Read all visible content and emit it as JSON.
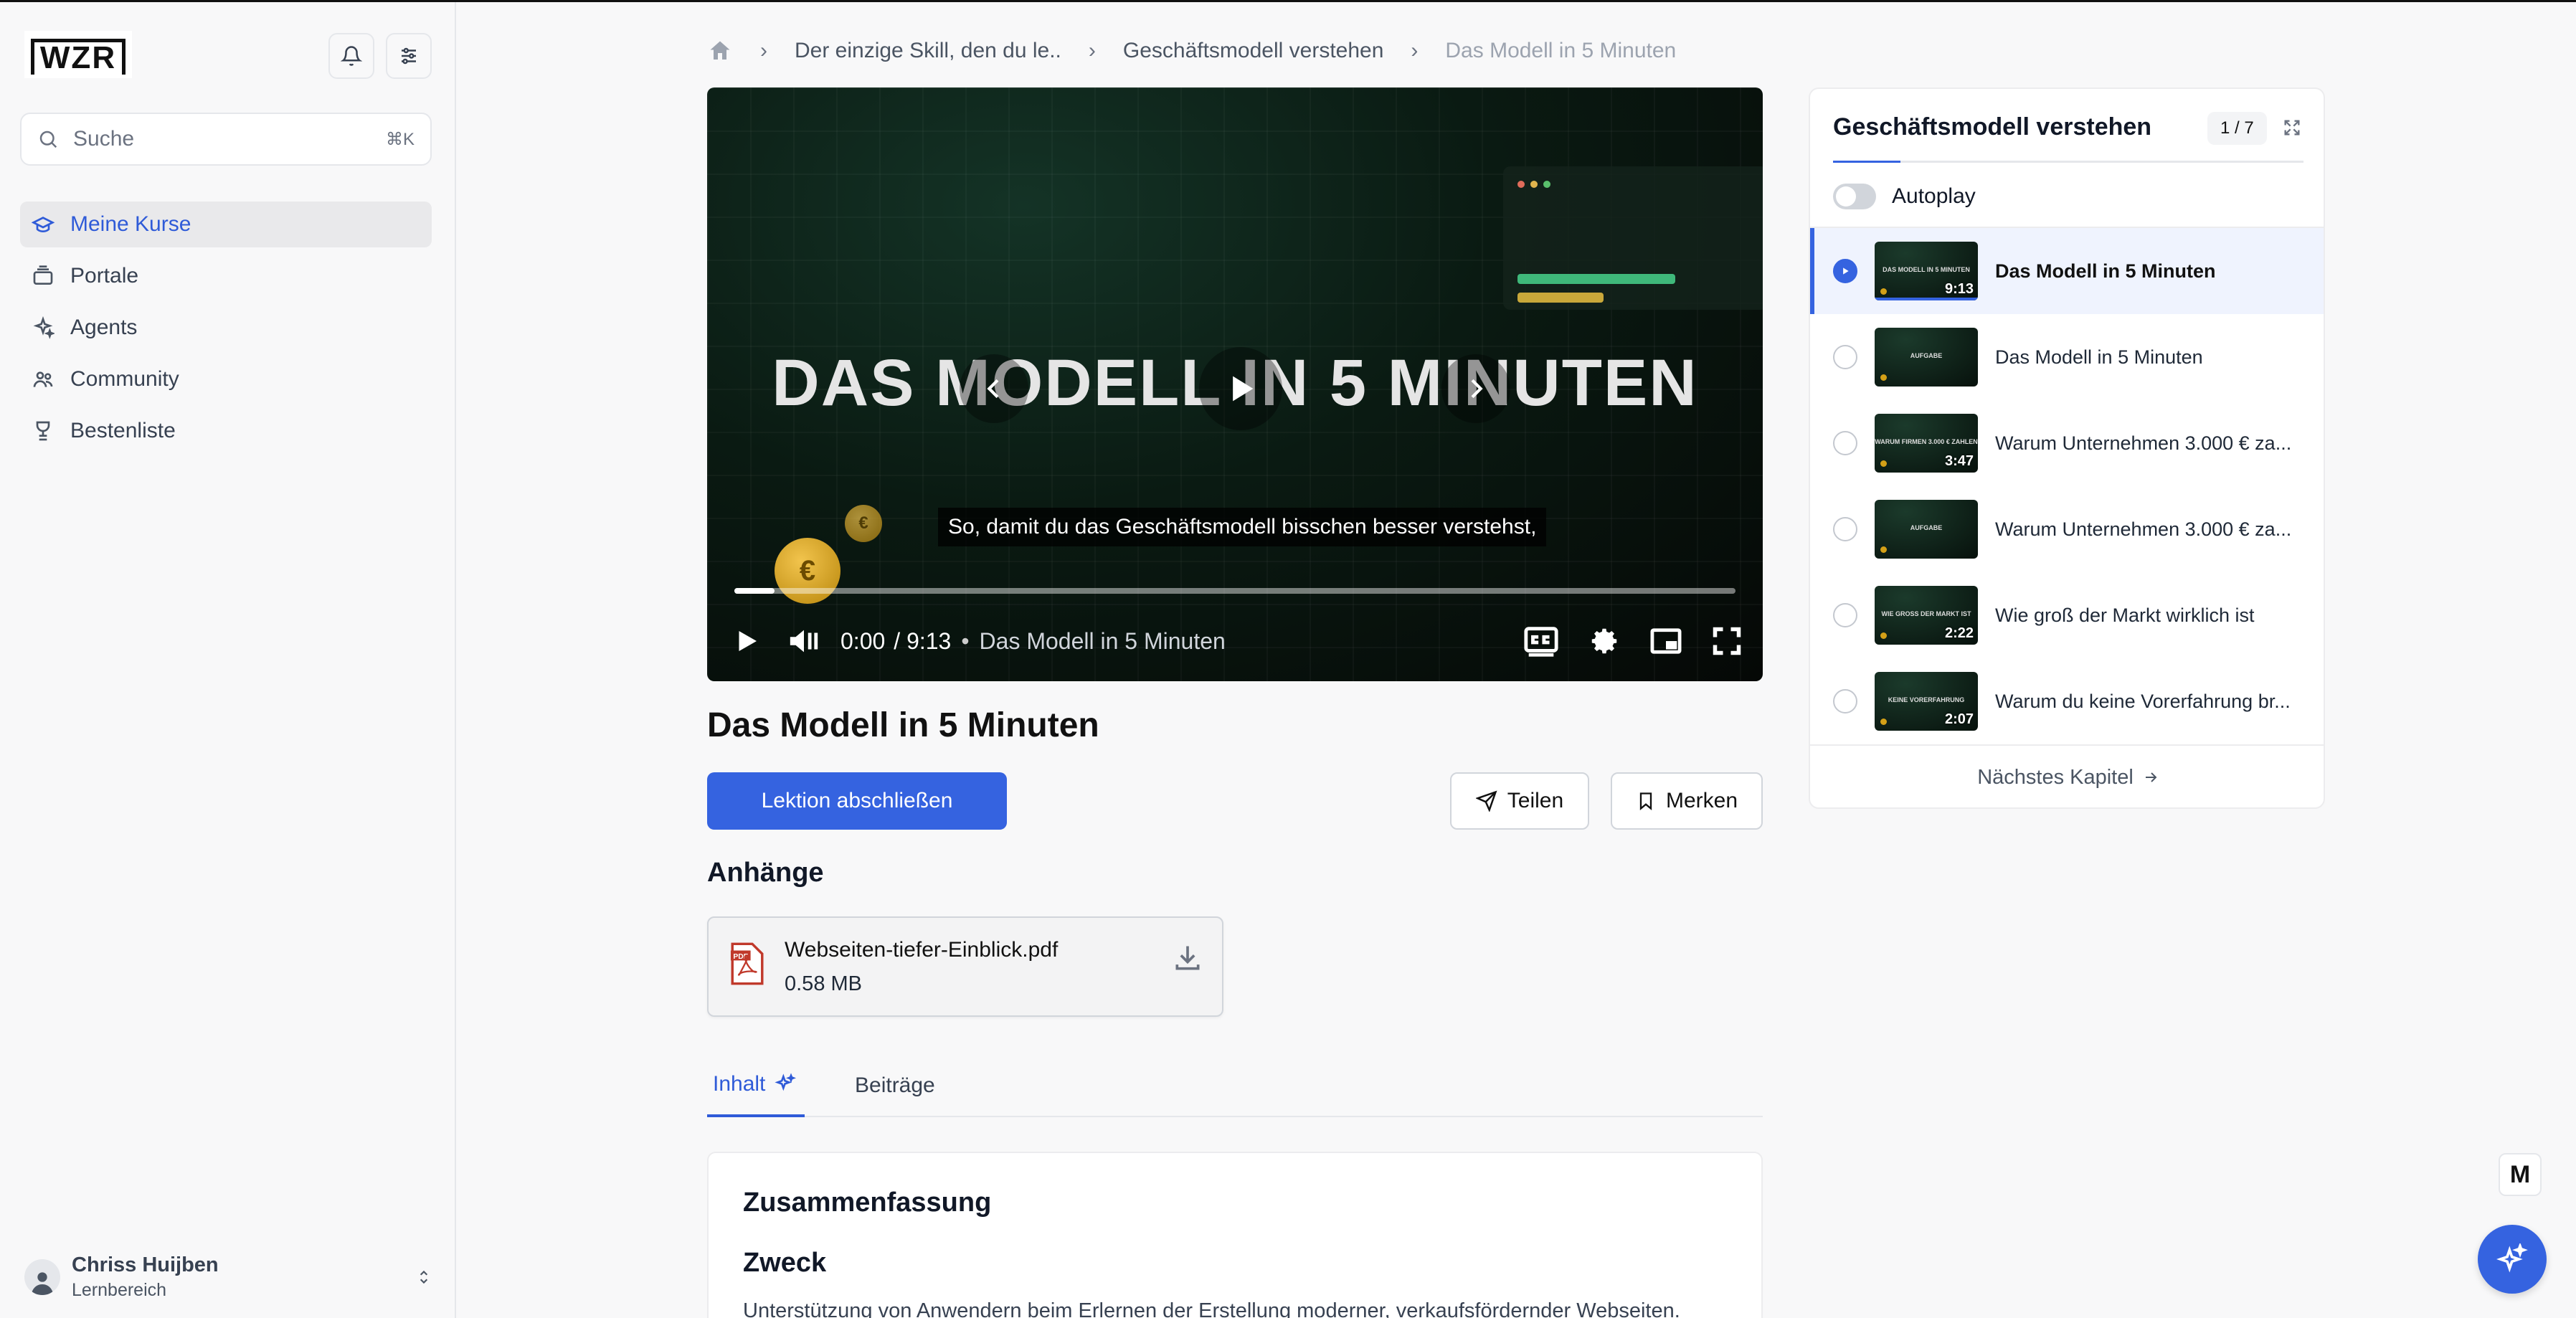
{
  "app": {
    "logo": "WZR"
  },
  "sidebar": {
    "search_placeholder": "Suche",
    "search_shortcut": "⌘K",
    "items": [
      {
        "label": "Meine Kurse",
        "icon": "graduation-cap-icon",
        "active": true
      },
      {
        "label": "Portale",
        "icon": "layers-icon"
      },
      {
        "label": "Agents",
        "icon": "sparkles-icon"
      },
      {
        "label": "Community",
        "icon": "users-icon"
      },
      {
        "label": "Bestenliste",
        "icon": "trophy-icon"
      }
    ],
    "user": {
      "name": "Chriss Huijben",
      "role": "Lernbereich"
    }
  },
  "breadcrumb": {
    "items": [
      "Der einzige Skill, den du le..",
      "Geschäftsmodell verstehen"
    ],
    "current": "Das Modell in 5 Minuten"
  },
  "video": {
    "overlay_title": "DAS MODELL IN 5 MINUTEN",
    "caption": "So, damit du das Geschäftsmodell bisschen besser verstehst,",
    "current_time": "0:00",
    "duration": "/ 9:13",
    "separator": "•",
    "title": "Das Modell in 5 Minuten",
    "progress": 0.04,
    "coin_symbol": "€"
  },
  "lesson": {
    "title": "Das Modell in 5 Minuten",
    "complete_label": "Lektion abschließen",
    "share_label": "Teilen",
    "bookmark_label": "Merken",
    "attachments_heading": "Anhänge",
    "attachment": {
      "name": "Webseiten-tiefer-Einblick.pdf",
      "size": "0.58 MB"
    },
    "tabs": [
      "Inhalt",
      "Beiträge"
    ],
    "summary_heading": "Zusammenfassung",
    "purpose_heading": "Zweck",
    "purpose_text": "Unterstützung von Anwendern beim Erlernen der Erstellung moderner, verkaufsfördernder Webseiten."
  },
  "chapter_panel": {
    "title": "Geschäftsmodell verstehen",
    "count": "1 / 7",
    "autoplay_label": "Autoplay",
    "autoplay_on": false,
    "items": [
      {
        "title": "Das Modell in 5 Minuten",
        "thumb_text": "DAS MODELL IN 5 MINUTEN",
        "duration": "9:13",
        "active": true
      },
      {
        "title": "Das Modell in 5 Minuten",
        "thumb_text": "AUFGABE",
        "duration": ""
      },
      {
        "title": "Warum Unternehmen 3.000 € za...",
        "thumb_text": "WARUM FIRMEN 3.000 € ZAHLEN",
        "duration": "3:47"
      },
      {
        "title": "Warum Unternehmen 3.000 € za...",
        "thumb_text": "AUFGABE",
        "duration": ""
      },
      {
        "title": "Wie groß der Markt wirklich ist",
        "thumb_text": "WIE GROSS DER MARKT IST",
        "duration": "2:22"
      },
      {
        "title": "Warum du keine Vorerfahrung br...",
        "thumb_text": "KEINE VORERFAHRUNG",
        "duration": "2:07"
      }
    ],
    "next_label": "Nächstes Kapitel"
  },
  "floating": {
    "badge_letter": "M"
  },
  "colors": {
    "accent": "#3563e0",
    "background": "#f8f8f9"
  }
}
